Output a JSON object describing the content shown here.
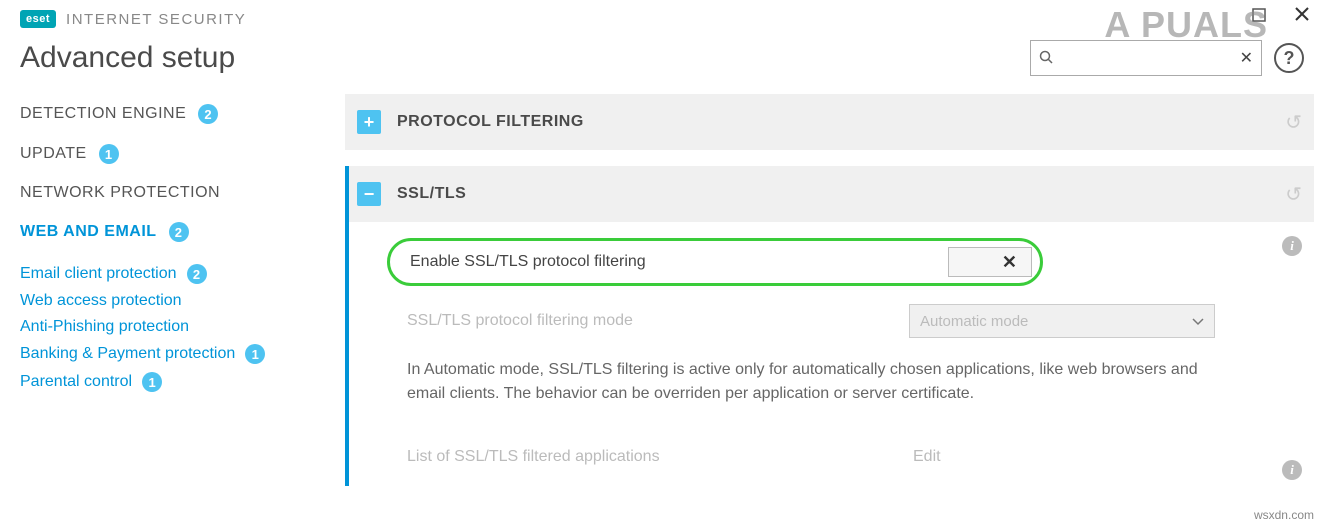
{
  "header": {
    "logo_text": "eset",
    "product_name": "INTERNET SECURITY"
  },
  "page_title": "Advanced setup",
  "search": {
    "placeholder": ""
  },
  "sidebar": {
    "items": [
      {
        "label": "DETECTION ENGINE",
        "badge": "2",
        "active": false
      },
      {
        "label": "UPDATE",
        "badge": "1",
        "active": false
      },
      {
        "label": "NETWORK PROTECTION",
        "badge": null,
        "active": false
      },
      {
        "label": "WEB AND EMAIL",
        "badge": "2",
        "active": true
      }
    ],
    "subitems": [
      {
        "label": "Email client protection",
        "badge": "2"
      },
      {
        "label": "Web access protection",
        "badge": null
      },
      {
        "label": "Anti-Phishing protection",
        "badge": null
      },
      {
        "label": "Banking & Payment protection",
        "badge": "1"
      },
      {
        "label": "Parental control",
        "badge": "1"
      }
    ]
  },
  "sections": {
    "protocol": {
      "title": "PROTOCOL FILTERING",
      "expanded": false
    },
    "ssltls": {
      "title": "SSL/TLS",
      "expanded": true,
      "enable_label": "Enable SSL/TLS protocol filtering",
      "enable_state_icon": "✕",
      "mode_label": "SSL/TLS protocol filtering mode",
      "mode_value": "Automatic mode",
      "description": "In Automatic mode, SSL/TLS filtering is active only for automatically chosen applications, like web browsers and email clients. The behavior can be overriden per application or server certificate.",
      "list_label": "List of SSL/TLS filtered applications",
      "edit_label": "Edit"
    }
  },
  "watermark": {
    "site": "wsxdn.com",
    "overlay": "A   PUALS"
  }
}
